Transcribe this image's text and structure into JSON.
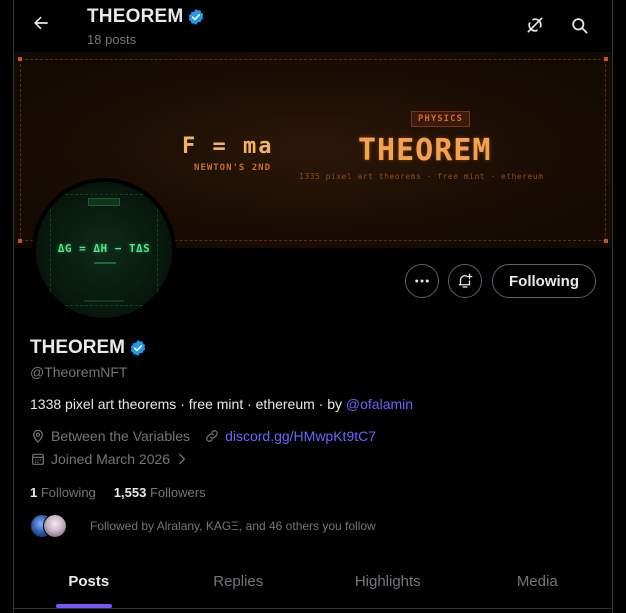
{
  "header": {
    "title": "THEOREM",
    "post_count": "18 posts",
    "back_icon": "arrow-left-icon",
    "grok_icon": "grok-icon",
    "search_icon": "search-icon"
  },
  "banner": {
    "formula": "F = ma",
    "formula_caption": "NEWTON'S 2ND",
    "tag": "PHYSICS",
    "title": "THEOREM",
    "tagline": "1335 pixel art theorems · free mint · ethereum"
  },
  "avatar": {
    "equation": "ΔG = ΔH − TΔS"
  },
  "actions": {
    "more_icon": "more-dots-icon",
    "notify_icon": "bell-plus-icon",
    "following_label": "Following"
  },
  "profile": {
    "display_name": "THEOREM",
    "handle": "@TheoremNFT",
    "bio_text": "1338 pixel art theorems · free mint · ethereum · by ",
    "bio_mention": "@ofalamin",
    "location": "Between the Variables",
    "link": "discord.gg/HMwpKt9tC7",
    "joined": "Joined March 2026",
    "following_count": "1",
    "following_label": "Following",
    "followers_count": "1,553",
    "followers_label": "Followers",
    "followed_by": "Followed by Alralany, KAGΞ, and 46 others you follow"
  },
  "tabs": [
    {
      "label": "Posts",
      "active": true
    },
    {
      "label": "Replies",
      "active": false
    },
    {
      "label": "Highlights",
      "active": false
    },
    {
      "label": "Media",
      "active": false
    }
  ],
  "colors": {
    "background": "#000000",
    "verified": "#1d9bf0",
    "link": "#6c63ff",
    "tab_indicator": "#7856ff",
    "muted": "#71767b"
  }
}
